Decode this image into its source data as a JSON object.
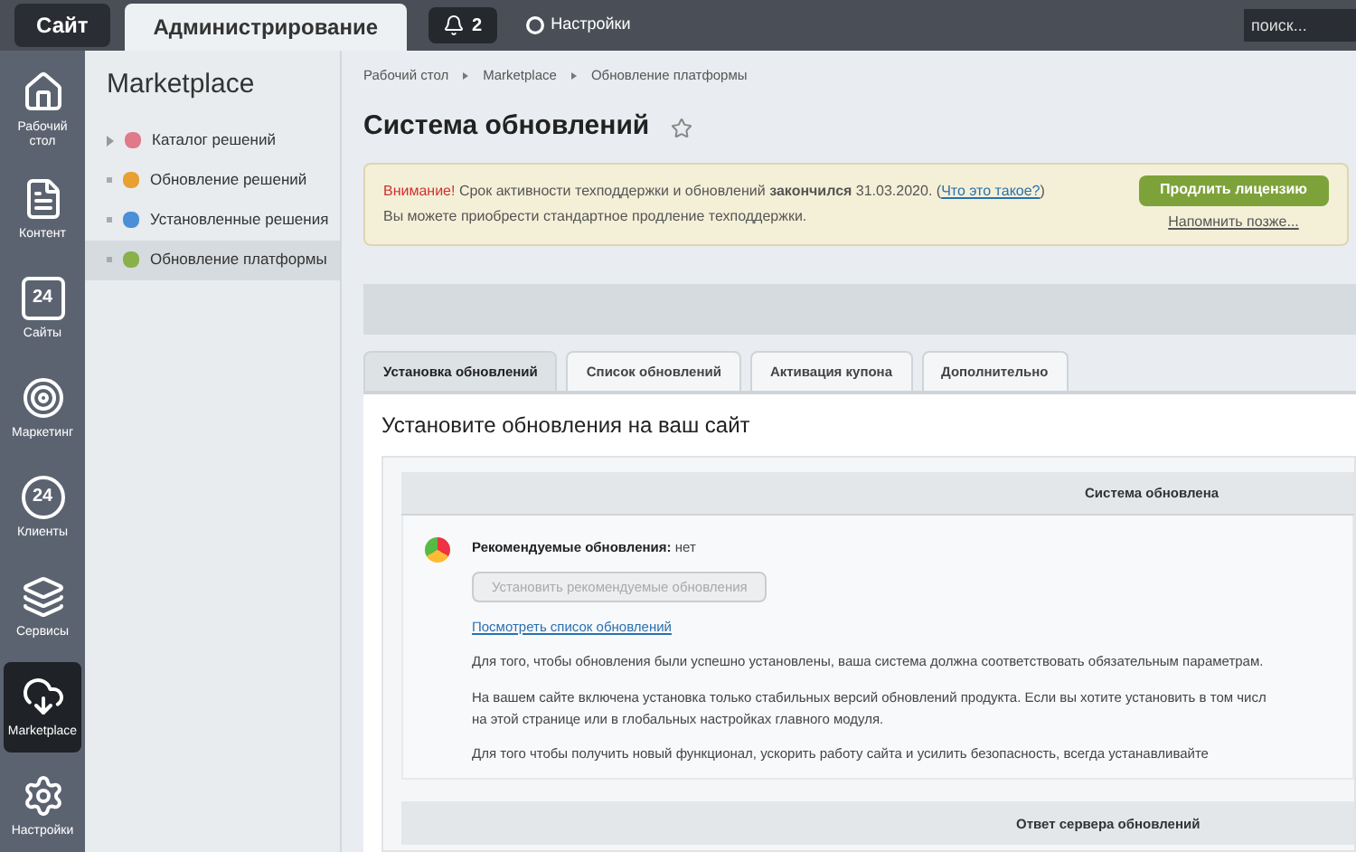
{
  "top_bar": {
    "tabs": [
      {
        "label": "Сайт",
        "selected": false
      },
      {
        "label": "Администрирование",
        "selected": true
      }
    ],
    "notifications": "2",
    "settings": "Настройки",
    "search": {
      "placeholder": "поиск..."
    }
  },
  "rail": [
    {
      "kind": "home",
      "label": "Рабочий стол",
      "selected": false
    },
    {
      "kind": "content",
      "label": "Контент",
      "selected": false
    },
    {
      "kind": "calendar",
      "label": "Сайты",
      "icon_text": "24",
      "selected": false
    },
    {
      "kind": "target",
      "label": "Маркетинг",
      "selected": false
    },
    {
      "kind": "clients",
      "label": "Клиенты",
      "icon_text": "24",
      "selected": false
    },
    {
      "kind": "layers",
      "label": "Сервисы",
      "selected": false
    },
    {
      "kind": "cloud",
      "label": "Marketplace",
      "selected": true
    },
    {
      "kind": "gear",
      "label": "Настройки",
      "selected": false
    }
  ],
  "sidebar": {
    "title": "Marketplace",
    "items": [
      {
        "label": "Каталог решений",
        "color": "#e07a8a",
        "expandable": true,
        "selected": false
      },
      {
        "label": "Обновление решений",
        "color": "#e8a030",
        "expandable": false,
        "selected": false
      },
      {
        "label": "Установленные решения",
        "color": "#4a8fd8",
        "expandable": false,
        "selected": false
      },
      {
        "label": "Обновление платформы",
        "color": "#8ab04a",
        "expandable": false,
        "selected": true
      }
    ]
  },
  "breadcrumbs": [
    "Рабочий стол",
    "Marketplace",
    "Обновление платформы"
  ],
  "page_title": "Система обновлений",
  "notice": {
    "warning": "Внимание!",
    "text": " Срок активности техподдержки и обновлений **закончился** 31.03.2020. (",
    "link": "Что это такое?",
    "close_paren": ")",
    "line2": "Вы можете приобрести стандартное продление техподдержки.",
    "button": "Продлить лицензию",
    "remind": "Напомнить позже..."
  },
  "tabs": [
    {
      "label": "Установка обновлений",
      "selected": true
    },
    {
      "label": "Список обновлений",
      "selected": false
    },
    {
      "label": "Активация купона",
      "selected": false
    },
    {
      "label": "Дополнительно",
      "selected": false
    }
  ],
  "section_title": "Установите обновления на ваш сайт",
  "status_header": "Система обновлена",
  "recommended": {
    "label": "Рекомендуемые обновления:",
    "value": "нет"
  },
  "install_button": {
    "label": "Установить рекомендуемые обновления",
    "disabled": true
  },
  "list_link": "Посмотреть список обновлений",
  "paragraphs": [
    "Для того, чтобы обновления были успешно установлены, ваша система должна соответствовать обязательным параметрам.",
    "На вашем сайте включена установка только стабильных версий обновлений продукта. Если вы хотите установить в том числ",
    "на этой странице или в глобальных настройках главного модуля.",
    "Для того чтобы получить новый функционал, ускорить работу сайта и усилить безопасность, всегда устанавливайте"
  ],
  "server_header": "Ответ сервера обновлений"
}
